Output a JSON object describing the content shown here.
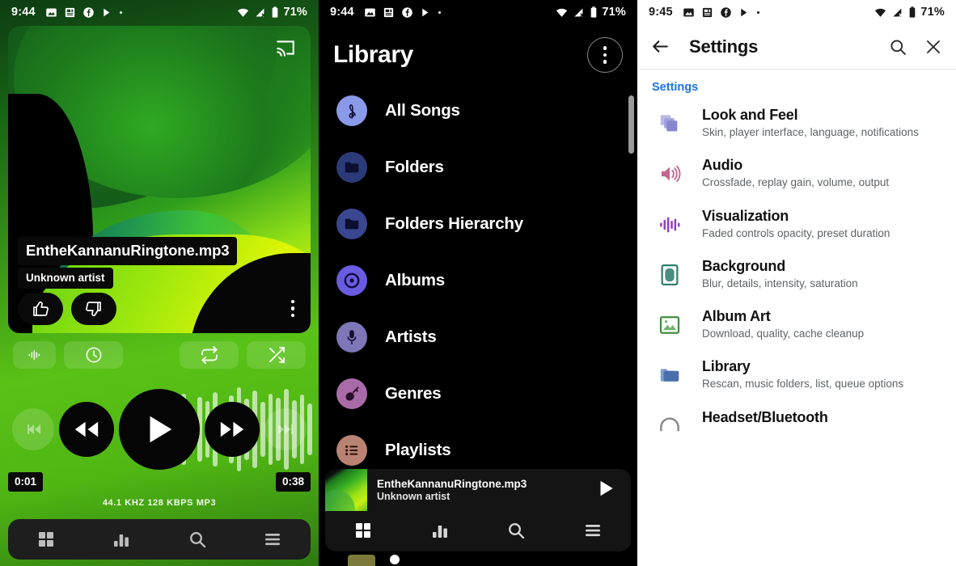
{
  "panels": {
    "player": {
      "status": {
        "time": "9:44",
        "battery": "71%",
        "icons": [
          "image-icon",
          "news-icon",
          "facebook-icon",
          "play-store-icon",
          "dot-icon"
        ],
        "right_icons": [
          "wifi-icon",
          "signal-off-icon",
          "battery-icon"
        ]
      },
      "cast_icon": "cast-icon",
      "track": {
        "title": "EntheKannanuRingtone.mp3",
        "artist": "Unknown artist"
      },
      "rating": {
        "thumbs_up": "thumbs-up-icon",
        "thumbs_down": "thumbs-down-icon",
        "overflow": "kebab-icon"
      },
      "chips": [
        {
          "name": "equalizer-chip",
          "icon": "equalizer-icon"
        },
        {
          "name": "sleep-timer-chip",
          "icon": "clock-icon"
        },
        {
          "name": "repeat-chip",
          "icon": "repeat-icon"
        },
        {
          "name": "shuffle-chip",
          "icon": "shuffle-icon"
        }
      ],
      "transport": {
        "prev_track": "skip-previous-icon",
        "rewind": "rewind-icon",
        "play": "play-icon",
        "forward": "fast-forward-icon",
        "next_track": "skip-next-icon"
      },
      "progress": {
        "elapsed": "0:01",
        "remaining": "0:38"
      },
      "format": "44.1 KHZ  128 KBPS  MP3",
      "nav": [
        {
          "name": "nav-grid",
          "icon": "grid-icon"
        },
        {
          "name": "nav-equalizer",
          "icon": "bars-icon"
        },
        {
          "name": "nav-search",
          "icon": "search-icon"
        },
        {
          "name": "nav-menu",
          "icon": "hamburger-icon"
        }
      ]
    },
    "library": {
      "status": {
        "time": "9:44",
        "battery": "71%"
      },
      "title": "Library",
      "overflow": "kebab-icon",
      "items": [
        {
          "label": "All Songs",
          "icon": "treble-clef-icon",
          "color": "#8a9ae8"
        },
        {
          "label": "Folders",
          "icon": "folder-icon",
          "color": "#2d3a7a"
        },
        {
          "label": "Folders Hierarchy",
          "icon": "folder-tree-icon",
          "color": "#3b4690"
        },
        {
          "label": "Albums",
          "icon": "disc-icon",
          "color": "#6a5ce0"
        },
        {
          "label": "Artists",
          "icon": "microphone-icon",
          "color": "#7d77b8"
        },
        {
          "label": "Genres",
          "icon": "guitar-icon",
          "color": "#a96ba8"
        },
        {
          "label": "Playlists",
          "icon": "list-icon",
          "color": "#b98373"
        }
      ],
      "miniplayer": {
        "title": "EntheKannanuRingtone.mp3",
        "artist": "Unknown artist",
        "play_icon": "play-icon"
      },
      "nav": [
        {
          "name": "nav-grid",
          "icon": "grid-icon"
        },
        {
          "name": "nav-equalizer",
          "icon": "bars-icon"
        },
        {
          "name": "nav-search",
          "icon": "search-icon"
        },
        {
          "name": "nav-menu",
          "icon": "hamburger-icon"
        }
      ]
    },
    "settings": {
      "status": {
        "time": "9:45",
        "battery": "71%"
      },
      "header": {
        "back": "back-arrow-icon",
        "title": "Settings",
        "search": "search-icon",
        "close": "close-icon"
      },
      "section_label": "Settings",
      "section_color": "#1a73e8",
      "items": [
        {
          "name": "Look and Feel",
          "desc": "Skin, player interface, language, notifications",
          "icon": "layers-icon",
          "color": "#8b8cd4"
        },
        {
          "name": "Audio",
          "desc": "Crossfade, replay gain, volume, output",
          "icon": "speaker-icon",
          "color": "#c26a8e"
        },
        {
          "name": "Visualization",
          "desc": "Faded controls opacity, preset duration",
          "icon": "waveform-icon",
          "color": "#8e44c8"
        },
        {
          "name": "Background",
          "desc": "Blur, details, intensity, saturation",
          "icon": "image-frame-icon",
          "color": "#2f7f6f"
        },
        {
          "name": "Album Art",
          "desc": "Download, quality, cache cleanup",
          "icon": "picture-icon",
          "color": "#3f8f3f"
        },
        {
          "name": "Library",
          "desc": "Rescan, music folders, list, queue options",
          "icon": "folder-icon",
          "color": "#4a6fae"
        },
        {
          "name": "Headset/Bluetooth",
          "desc": "",
          "icon": "headphones-icon",
          "color": "#777777"
        }
      ]
    }
  }
}
